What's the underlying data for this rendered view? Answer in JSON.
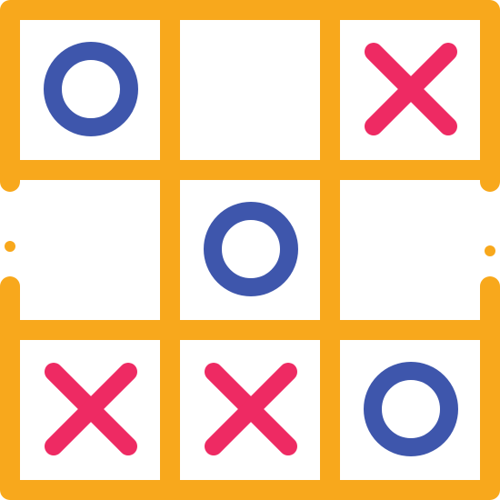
{
  "game": {
    "board": [
      [
        "O",
        "",
        "X"
      ],
      [
        "",
        "O",
        ""
      ],
      [
        "X",
        "X",
        "O"
      ]
    ]
  },
  "colors": {
    "frame": "#F8A81C",
    "x_mark": "#EE2A63",
    "o_mark": "#3E56AC",
    "cell_bg": "#FFFFFF"
  },
  "icons": {
    "x_mark": "x-mark-icon",
    "o_mark": "o-mark-icon"
  }
}
